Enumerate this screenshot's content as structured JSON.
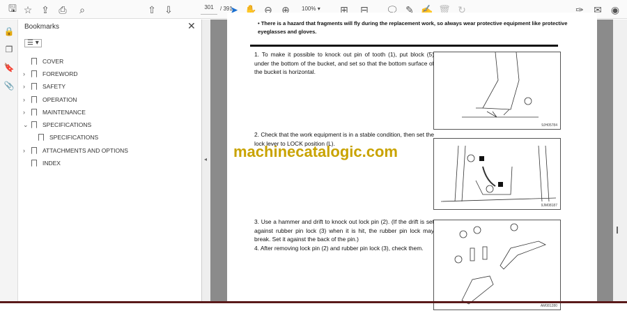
{
  "toolbar": {
    "icons": [
      "save-icon",
      "bookmark-star-icon",
      "upload-icon",
      "print-icon",
      "search-icon",
      "page-up-icon",
      "page-down-icon",
      "select-cursor-icon",
      "hand-icon",
      "zoom-out-icon",
      "zoom-in-icon",
      "fit-page-icon",
      "scroll-mode-icon",
      "comment-icon",
      "highlight-icon",
      "sign-icon",
      "delete-icon",
      "rotate-icon",
      "share-sign-icon",
      "email-icon",
      "account-icon"
    ],
    "page_current": "301",
    "page_total": "/ 391",
    "zoom": "100%"
  },
  "bookmarks": {
    "title": "Bookmarks",
    "items": [
      {
        "label": "COVER"
      },
      {
        "label": "FOREWORD"
      },
      {
        "label": "SAFETY"
      },
      {
        "label": "OPERATION"
      },
      {
        "label": "MAINTENANCE"
      },
      {
        "label": "SPECIFICATIONS",
        "expanded": true
      },
      {
        "label": "SPECIFICATIONS",
        "child": true
      },
      {
        "label": "ATTACHMENTS AND OPTIONS"
      },
      {
        "label": "INDEX"
      }
    ]
  },
  "document": {
    "warning": "There is a hazard that fragments will fly during the replacement work, so always wear protective equipment like protective eyeglasses and gloves.",
    "steps": [
      "1. To make it possible to knock out pin of tooth (1), put block (5) under the bottom of the bucket, and set so that the bottom surface of the bucket is horizontal.",
      "2. Check that the work equipment is in a stable condition, then set the lock lever to LOCK position (L).",
      "3. Use a hammer and drift to knock out lock pin (2). (If the drift is set against rubber pin lock (3) when it is hit, the rubber pin lock may break. Set it against the back of the pin.)",
      "4. After removing lock pin (2) and rubber pin lock (3), check them."
    ],
    "figure_codes": [
      "9JH05784",
      "9JM08187",
      "AM081280"
    ],
    "watermark": "machinecatalogic.com"
  }
}
